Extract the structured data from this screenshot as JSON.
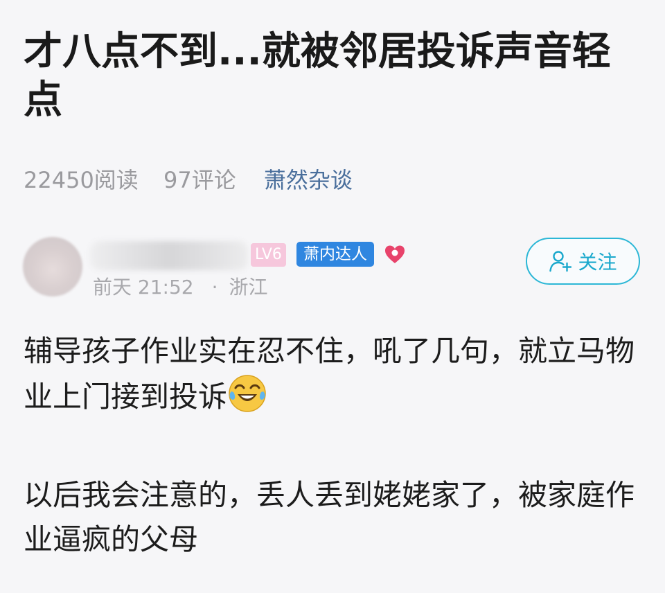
{
  "article": {
    "title": "才八点不到...就被邻居投诉声音轻点",
    "reads": "22450阅读",
    "comments": "97评论",
    "channel": "萧然杂谈"
  },
  "author": {
    "level_badge": "LV6",
    "expert_badge": "萧内达人",
    "time": "前天 21:52",
    "separator": "·",
    "location": "浙江"
  },
  "follow": {
    "label": "关注"
  },
  "content": {
    "paragraph1": "辅导孩子作业实在忍不住，吼了几句，就立马物业上门接到投诉",
    "paragraph2": "以后我会注意的，丢人丢到姥姥家了，被家庭作业逼疯的父母"
  },
  "colors": {
    "channel": "#4a6f9c",
    "level_badge_bg": "#f6c7dc",
    "expert_badge_bg": "#2f86e0",
    "follow_accent": "#1aa8cc",
    "heart": "#e8436b"
  },
  "icons": {
    "heart": "heart-icon",
    "follow": "user-plus-icon",
    "emoji": "laugh-cry-emoji-icon"
  }
}
